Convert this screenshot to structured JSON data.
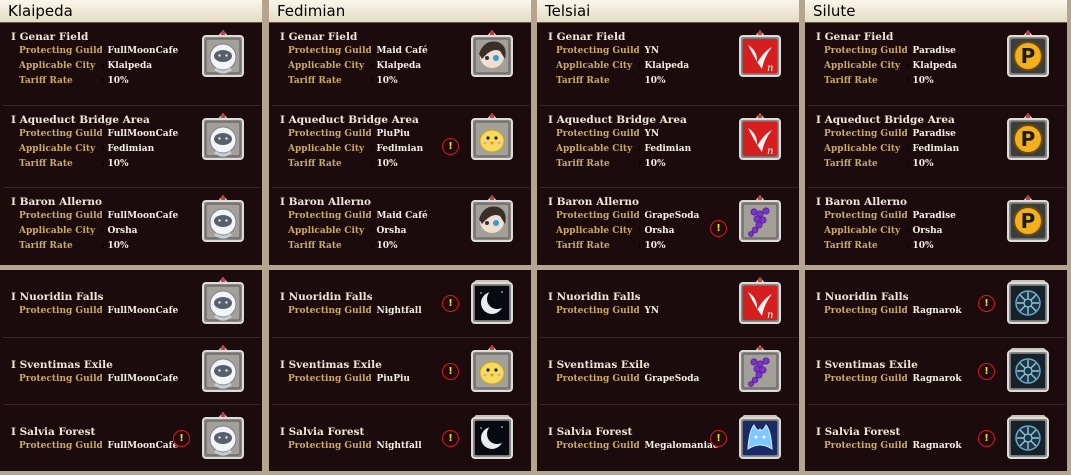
{
  "colors": {
    "background": "#1c0b0d",
    "border": "#b5a58e",
    "label": "#c9a86c",
    "value": "#f4efe6",
    "alert_ring": "#d21d1d",
    "alert_mark": "#f1d84b"
  },
  "labels": {
    "guild": "Protecting Guild",
    "city": "Applicable City",
    "tariff": "Tariff Rate",
    "sep": ":"
  },
  "columns": [
    {
      "header": "Klaipeda",
      "top": [
        {
          "title": "I Genar Field",
          "guild": "FullMoonCafe",
          "city": "Klaipeda",
          "tariff": "10%",
          "emblem": "fullmooncafe-emblem-icon",
          "alert": false
        },
        {
          "title": "I Aqueduct Bridge Area",
          "guild": "FullMoonCafe",
          "city": "Fedimian",
          "tariff": "10%",
          "emblem": "fullmooncafe-emblem-icon",
          "alert": false
        },
        {
          "title": "I Baron Allerno",
          "guild": "FullMoonCafe",
          "city": "Orsha",
          "tariff": "10%",
          "emblem": "fullmooncafe-emblem-icon",
          "alert": false
        }
      ],
      "bottom": [
        {
          "title": "I Nuoridin Falls",
          "guild": "FullMoonCafe",
          "emblem": "fullmooncafe-emblem-icon",
          "alert": false
        },
        {
          "title": "I Sventimas Exile",
          "guild": "FullMoonCafe",
          "emblem": "fullmooncafe-emblem-icon",
          "alert": false
        },
        {
          "title": "I Salvia Forest",
          "guild": "FullMoonCafe",
          "emblem": "fullmooncafe-emblem-icon",
          "alert": true
        }
      ]
    },
    {
      "header": "Fedimian",
      "top": [
        {
          "title": "I Genar Field",
          "guild": "Maid Café",
          "city": "Klaipeda",
          "tariff": "10%",
          "emblem": "maid-cafe-emblem-icon",
          "alert": false
        },
        {
          "title": "I Aqueduct Bridge Area",
          "guild": "PiuPiu",
          "city": "Fedimian",
          "tariff": "10%",
          "emblem": "piupiu-chick-emblem-icon",
          "alert": true
        },
        {
          "title": "I Baron Allerno",
          "guild": "Maid Café",
          "city": "Orsha",
          "tariff": "10%",
          "emblem": "maid-cafe-emblem-icon",
          "alert": false
        }
      ],
      "bottom": [
        {
          "title": "I Nuoridin Falls",
          "guild": "Nightfall",
          "emblem": "nightfall-moon-emblem-icon",
          "alert": true
        },
        {
          "title": "I Sventimas Exile",
          "guild": "PiuPiu",
          "emblem": "piupiu-chick-emblem-icon",
          "alert": true
        },
        {
          "title": "I Salvia Forest",
          "guild": "Nightfall",
          "emblem": "nightfall-moon-emblem-icon",
          "alert": true
        }
      ]
    },
    {
      "header": "Telsiai",
      "top": [
        {
          "title": "I Genar Field",
          "guild": "YN",
          "city": "Klaipeda",
          "tariff": "10%",
          "emblem": "yn-emblem-icon",
          "alert": false
        },
        {
          "title": "I Aqueduct Bridge Area",
          "guild": "YN",
          "city": "Fedimian",
          "tariff": "10%",
          "emblem": "yn-emblem-icon",
          "alert": false
        },
        {
          "title": "I Baron Allerno",
          "guild": "GrapeSoda",
          "city": "Orsha",
          "tariff": "10%",
          "emblem": "grapesoda-emblem-icon",
          "alert": true
        }
      ],
      "bottom": [
        {
          "title": "I Nuoridin Falls",
          "guild": "YN",
          "emblem": "yn-emblem-icon",
          "alert": false
        },
        {
          "title": "I Sventimas Exile",
          "guild": "GrapeSoda",
          "emblem": "grapesoda-emblem-icon",
          "alert": false
        },
        {
          "title": "I Salvia Forest",
          "guild": "Megalomaniac",
          "emblem": "megalomaniac-emblem-icon",
          "alert": true
        }
      ]
    },
    {
      "header": "Silute",
      "top": [
        {
          "title": "I Genar Field",
          "guild": "Paradise",
          "city": "Klaipeda",
          "tariff": "10%",
          "emblem": "paradise-p-emblem-icon",
          "alert": false
        },
        {
          "title": "I Aqueduct Bridge Area",
          "guild": "Paradise",
          "city": "Fedimian",
          "tariff": "10%",
          "emblem": "paradise-p-emblem-icon",
          "alert": false
        },
        {
          "title": "I Baron Allerno",
          "guild": "Paradise",
          "city": "Orsha",
          "tariff": "10%",
          "emblem": "paradise-p-emblem-icon",
          "alert": false
        }
      ],
      "bottom": [
        {
          "title": "I Nuoridin Falls",
          "guild": "Ragnarok",
          "emblem": "ragnarok-emblem-icon",
          "alert": true
        },
        {
          "title": "I Sventimas Exile",
          "guild": "Ragnarok",
          "emblem": "ragnarok-emblem-icon",
          "alert": true
        },
        {
          "title": "I Salvia Forest",
          "guild": "Ragnarok",
          "emblem": "ragnarok-emblem-icon",
          "alert": true
        }
      ]
    }
  ]
}
